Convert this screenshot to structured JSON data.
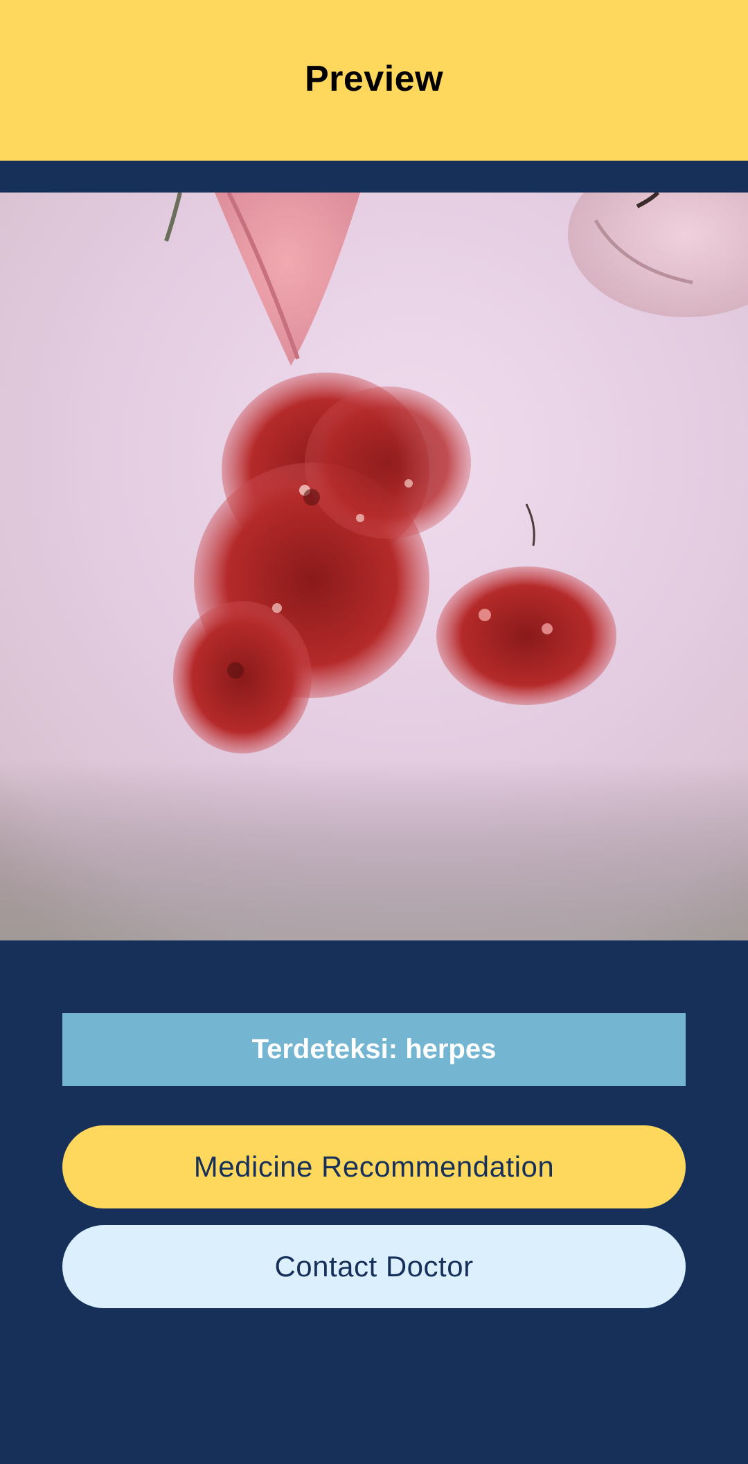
{
  "header": {
    "title": "Preview"
  },
  "preview": {
    "image_name": "skin-lesion-photo"
  },
  "result": {
    "text": "Terdeteksi: herpes"
  },
  "actions": {
    "medicine_label": "Medicine Recommendation",
    "doctor_label": "Contact Doctor"
  },
  "colors": {
    "header_bg": "#fed85d",
    "page_bg": "#16305a",
    "result_bg": "#74b6d1",
    "primary_button": "#fed85d",
    "secondary_button": "#dbeffc"
  }
}
